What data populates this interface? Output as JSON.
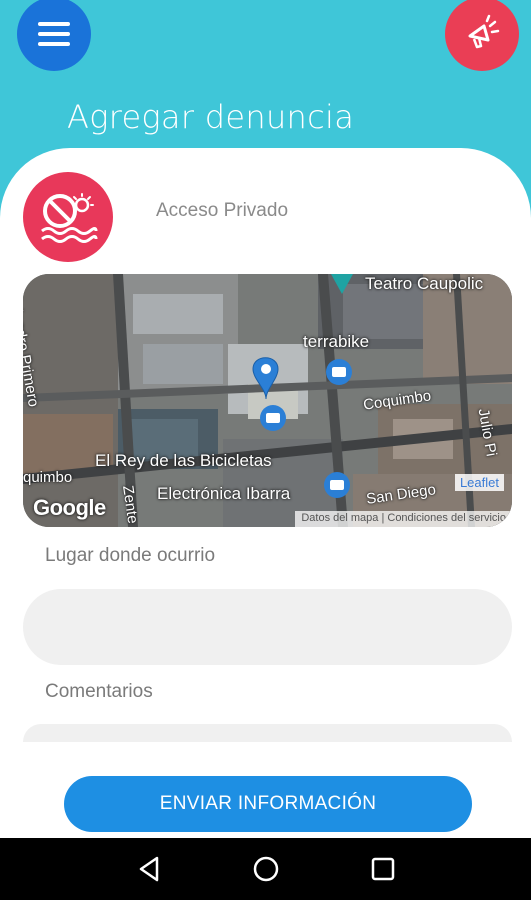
{
  "header": {
    "title": "Agregar denuncia",
    "menu_icon": "menu-icon",
    "alert_icon": "megaphone-icon"
  },
  "category": {
    "icon": "no-swimming-beach-icon",
    "label": "Acceso Privado"
  },
  "map": {
    "labels": {
      "teatro": "Teatro Caupolic",
      "terrabike": "terrabike",
      "coquimbo": "Coquimbo",
      "alejandro": "lejandro Primero",
      "julio": "Julio Pi",
      "coquimbo2": "quimbo",
      "rey": "El Rey de las Bicicletas",
      "zenteno": "Zente",
      "electronica": "Electrónica Ibarra",
      "sandiego": "San Diego"
    },
    "google": "Google",
    "leaflet": "Leaflet",
    "attribution": "Datos del mapa  |  Condiciones del servicio"
  },
  "form": {
    "place_label": "Lugar donde ocurrio",
    "place_value": "",
    "comments_label": "Comentarios",
    "comments_value": ""
  },
  "submit_label": "ENVIAR INFORMACIÓN",
  "colors": {
    "background": "#3fc6d8",
    "menu_button": "#1a73d9",
    "alert_button": "#ea3e55",
    "submit_button": "#1e8fe3"
  },
  "system_nav": [
    "back-icon",
    "home-icon",
    "recents-icon"
  ]
}
